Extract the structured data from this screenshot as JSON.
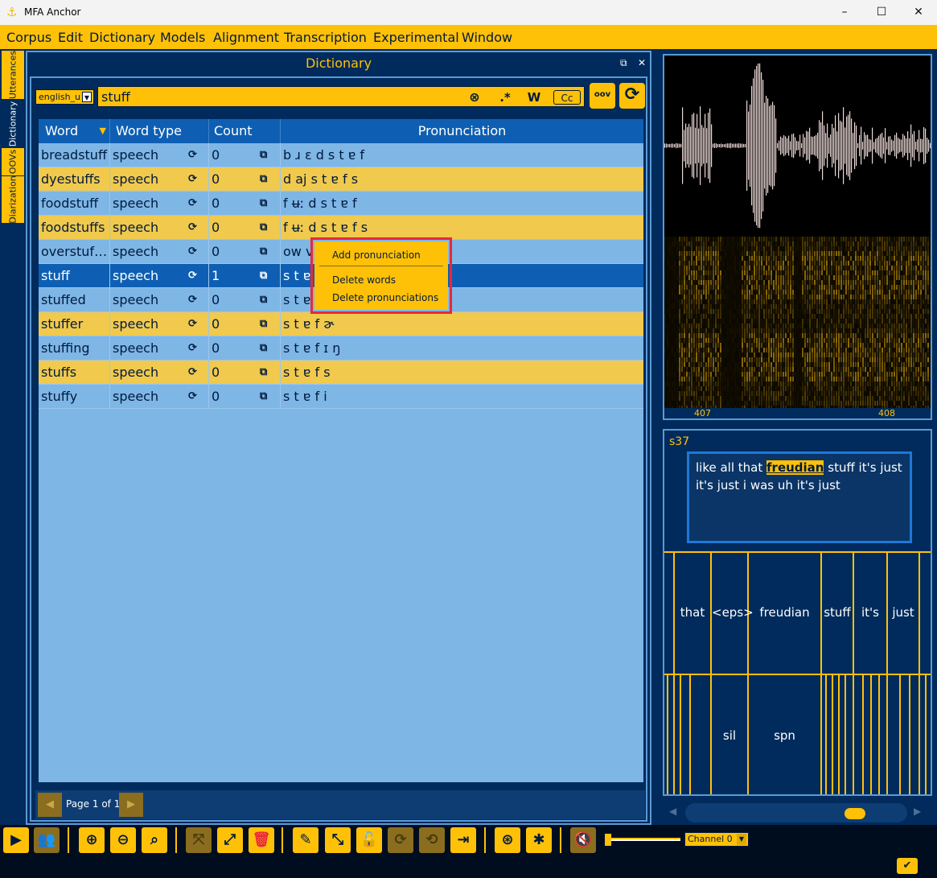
{
  "window": {
    "title": "MFA Anchor",
    "logo_icon": "anchor-icon"
  },
  "menu": [
    "Corpus",
    "Edit",
    "Dictionary",
    "Models",
    "Alignment",
    "Transcription",
    "Experimental",
    "Window"
  ],
  "side_tabs": [
    "Utterances",
    "Dictionary",
    "OOVs",
    "Diarization"
  ],
  "dictionary": {
    "title": "Dictionary",
    "selected_dictionary": "english_u",
    "search_value": "stuff",
    "search_options": {
      "regex": ".*",
      "word": "W",
      "case": "Cc"
    },
    "oov_label": "oov",
    "columns": [
      "Word",
      "Word type",
      "Count",
      "Pronunciation"
    ],
    "rows": [
      {
        "word": "breadstuff",
        "type": "speech",
        "count": "0",
        "pron": "b ɹ ɛ d s t ɐ f"
      },
      {
        "word": "dyestuffs",
        "type": "speech",
        "count": "0",
        "pron": "d aj s t ɐ f s"
      },
      {
        "word": "foodstuff",
        "type": "speech",
        "count": "0",
        "pron": "f ʉː d s t ɐ f"
      },
      {
        "word": "foodstuffs",
        "type": "speech",
        "count": "0",
        "pron": "f ʉː d s t ɐ f s"
      },
      {
        "word": "overstuf…",
        "type": "speech",
        "count": "0",
        "pron": "ow v"
      },
      {
        "word": "stuff",
        "type": "speech",
        "count": "1",
        "pron": "s t ɐ"
      },
      {
        "word": "stuffed",
        "type": "speech",
        "count": "0",
        "pron": "s t ɐ"
      },
      {
        "word": "stuffer",
        "type": "speech",
        "count": "0",
        "pron": "s t ɐ f ɚ"
      },
      {
        "word": "stuffing",
        "type": "speech",
        "count": "0",
        "pron": "s t ɐ f ɪ ŋ"
      },
      {
        "word": "stuffs",
        "type": "speech",
        "count": "0",
        "pron": "s t ɐ f s"
      },
      {
        "word": "stuffy",
        "type": "speech",
        "count": "0",
        "pron": "s t ɐ f i"
      }
    ],
    "page_label": "Page 1 of 1"
  },
  "context_menu": [
    "Add pronunciation",
    "Delete words",
    "Delete pronunciations"
  ],
  "waveform": {
    "axis_labels": [
      "407",
      "408"
    ]
  },
  "transcript": {
    "speaker": "s37",
    "text_before": "like all that ",
    "highlight": "freudian",
    "text_after": " stuff it's just it's just i was uh it's just",
    "word_tier": [
      "that",
      "<eps>",
      "freudian",
      "stuff",
      "it's",
      "just"
    ],
    "phone_tier": [
      "sil",
      "spn"
    ]
  },
  "toolbar": {
    "channel": "Channel 0"
  },
  "colors": {
    "accent": "#ffc107",
    "background": "#002b5c",
    "table_row": "#7eb6e6",
    "selected_row": "#0e5fb3",
    "highlight_box": "#e8283c"
  }
}
